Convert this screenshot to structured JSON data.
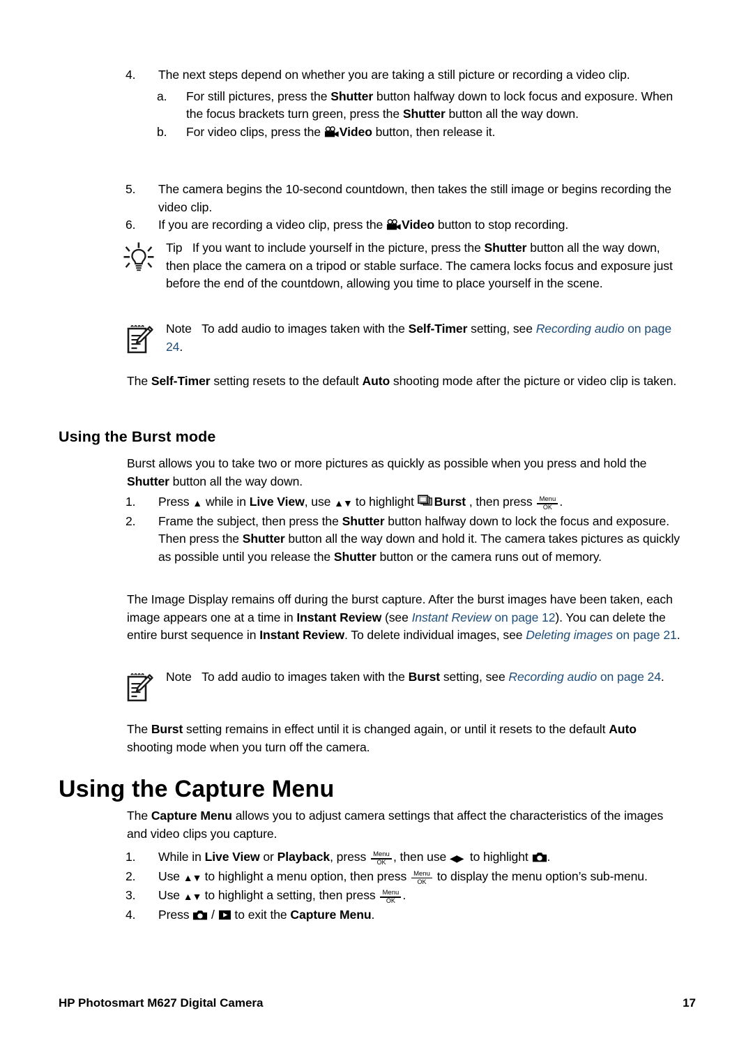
{
  "document": {
    "title": "HP Photosmart M627 Digital Camera",
    "page_number": "17",
    "link_color": "#1F4E79"
  },
  "steps_continued": {
    "item4": {
      "num": "4.",
      "text": "The next steps depend on whether you are taking a still picture or recording a video clip."
    },
    "item4a": {
      "num": "a.",
      "part1": "For still pictures, press the ",
      "bold1": "Shutter",
      "part2": " button halfway down to lock focus and exposure. When the focus brackets turn green, press the ",
      "bold2": "Shutter",
      "part3": " button all the way down."
    },
    "item4b": {
      "num": "b.",
      "part1": "For video clips, press the ",
      "bold1": "Video",
      "part2": " button, then release it.",
      "icon": "video-camera-icon"
    },
    "item5": {
      "num": "5.",
      "text": "The camera begins the 10-second countdown, then takes the still image or begins recording the video clip."
    },
    "item6": {
      "num": "6.",
      "part1": "If you are recording a video clip, press the ",
      "bold1": "Video",
      "part2": " button to stop recording.",
      "icon": "video-camera-icon"
    }
  },
  "tip_callout": {
    "icon": "lightbulb-icon",
    "label": "Tip",
    "part1": "If you want to include yourself in the picture, press the ",
    "bold1": "Shutter",
    "part2": " button all the way down, then place the camera on a tripod or stable surface. The camera locks focus and exposure just before the end of the countdown, allowing you time to place yourself in the scene."
  },
  "note_callout_1": {
    "icon": "note-pencil-icon",
    "label": "Note",
    "part1": "To add audio to images taken with the ",
    "bold1": "Self-Timer",
    "part2": " setting, see ",
    "link": "Recording audio",
    "link_tail": " on page 24",
    "part3": "."
  },
  "selftimer_paragraph": {
    "part1": "The ",
    "bold1": "Self-Timer",
    "part2": " setting resets to the default ",
    "bold2": "Auto",
    "part3": " shooting mode after the picture or video clip is taken."
  },
  "burst_section": {
    "heading": "Using the Burst mode",
    "intro": {
      "part1": "Burst allows you to take two or more pictures as quickly as possible when you press and hold the ",
      "bold1": "Shutter",
      "part2": " button all the way down."
    },
    "item1": {
      "num": "1.",
      "part1": "Press ",
      "arrow_up": "up-arrow-icon",
      "part2": " while in ",
      "bold1": "Live View",
      "part3": ", use ",
      "arrow_updown": "up-down-arrow-icon",
      "part4": " to highlight ",
      "burst_icon": "burst-icon",
      "bold2": "Burst",
      "part5": " , then press ",
      "menuok": "menu-ok-icon",
      "part6": "."
    },
    "item2": {
      "num": "2.",
      "part1": "Frame the subject, then press the ",
      "bold1": "Shutter",
      "part2": " button halfway down to lock the focus and exposure. Then press the ",
      "bold2": "Shutter",
      "part3": " button all the way down and hold it. The camera takes pictures as quickly as possible until you release the ",
      "bold3": "Shutter",
      "part4": " button or the camera runs out of memory."
    },
    "display_paragraph": {
      "part1": "The Image Display remains off during the burst capture. After the burst images have been taken, each image appears one at a time in ",
      "bold1": "Instant Review",
      "part2": " (see ",
      "link1": "Instant Review",
      "link1_tail": " on page 12",
      "part3": "). You can delete the entire burst sequence in ",
      "bold2": "Instant Review",
      "part4": ". To delete individual images, see ",
      "link2": "Deleting images",
      "link2_tail": " on page 21",
      "part5": "."
    },
    "note": {
      "icon": "note-pencil-icon",
      "label": "Note",
      "part1": "To add audio to images taken with the ",
      "bold1": "Burst",
      "part2": " setting, see ",
      "link": "Recording audio",
      "link_tail": " on page 24",
      "part3": "."
    },
    "closing": {
      "part1": "The ",
      "bold1": "Burst",
      "part2": " setting remains in effect until it is changed again, or until it resets to the default ",
      "bold2": "Auto",
      "part3": " shooting mode when you turn off the camera."
    }
  },
  "capture_menu_section": {
    "heading": "Using the Capture Menu",
    "intro": {
      "part1": "The ",
      "bold1": "Capture Menu",
      "part2": " allows you to adjust camera settings that affect the characteristics of the images and video clips you capture."
    },
    "item1": {
      "num": "1.",
      "part1": "While in ",
      "bold1": "Live View",
      "part2": " or ",
      "bold2": "Playback",
      "part3": ", press ",
      "menuok": "menu-ok-icon",
      "part4": ", then use ",
      "arrow_leftright": "left-right-arrow-icon",
      "part5": " to highlight ",
      "camera_icon": "still-camera-icon",
      "part6": "."
    },
    "item2": {
      "num": "2.",
      "part1": "Use ",
      "arrow_updown": "up-down-arrow-icon",
      "part2": " to highlight a menu option, then press ",
      "menuok": "menu-ok-icon",
      "part3": " to display the menu option’s sub-menu."
    },
    "item3": {
      "num": "3.",
      "part1": "Use ",
      "arrow_updown": "up-down-arrow-icon",
      "part2": " to highlight a setting, then press ",
      "menuok": "menu-ok-icon",
      "part3": "."
    },
    "item4": {
      "num": "4.",
      "part1": "Press ",
      "camera_icon": "still-camera-icon",
      "slash": " / ",
      "playback_icon": "playback-icon",
      "part2": " to exit the ",
      "bold1": "Capture Menu",
      "part3": "."
    }
  },
  "icon_labels": {
    "menu": "Menu",
    "ok": "OK",
    "up_arrow": "▲",
    "down_arrow": "▼",
    "left_arrow": "◀",
    "right_arrow": "▶"
  }
}
